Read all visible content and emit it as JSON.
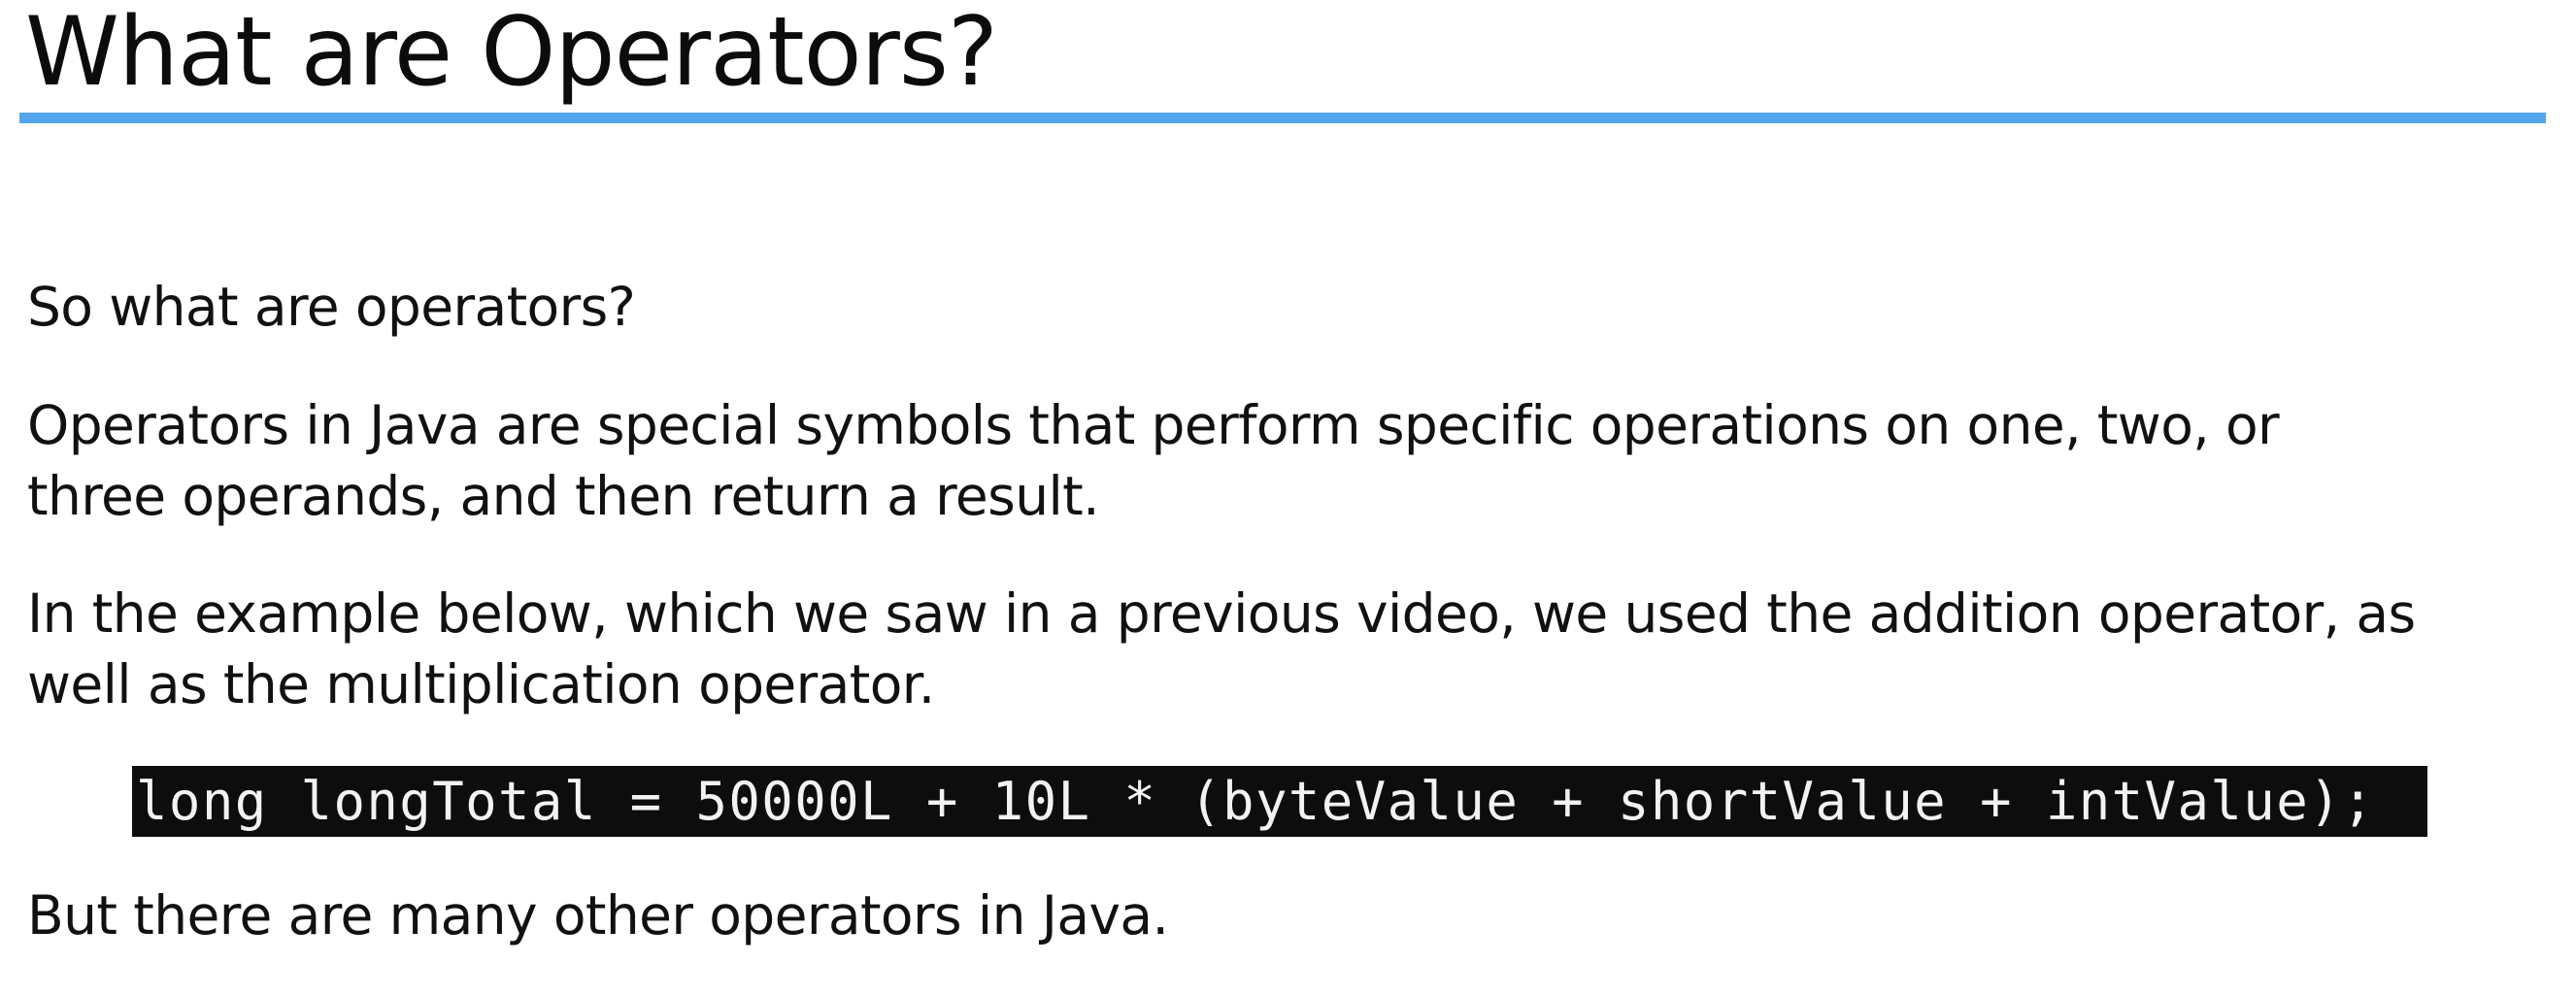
{
  "slide": {
    "title": "What are Operators?",
    "accent_color": "#54a6ec"
  },
  "content": {
    "intro": "So what are operators?",
    "definition_line_1": "Operators in Java are special symbols that perform specific operations on one, two, or",
    "definition_line_2": "three operands, and then return a result.",
    "example_line_1": "In the example below, which we saw in a previous video, we used the addition operator, as",
    "example_line_2": "well as the multiplication operator.",
    "code": "long longTotal = 50000L + 10L * (byteValue + shortValue + intValue);",
    "closing": "But there are many other operators in Java."
  }
}
